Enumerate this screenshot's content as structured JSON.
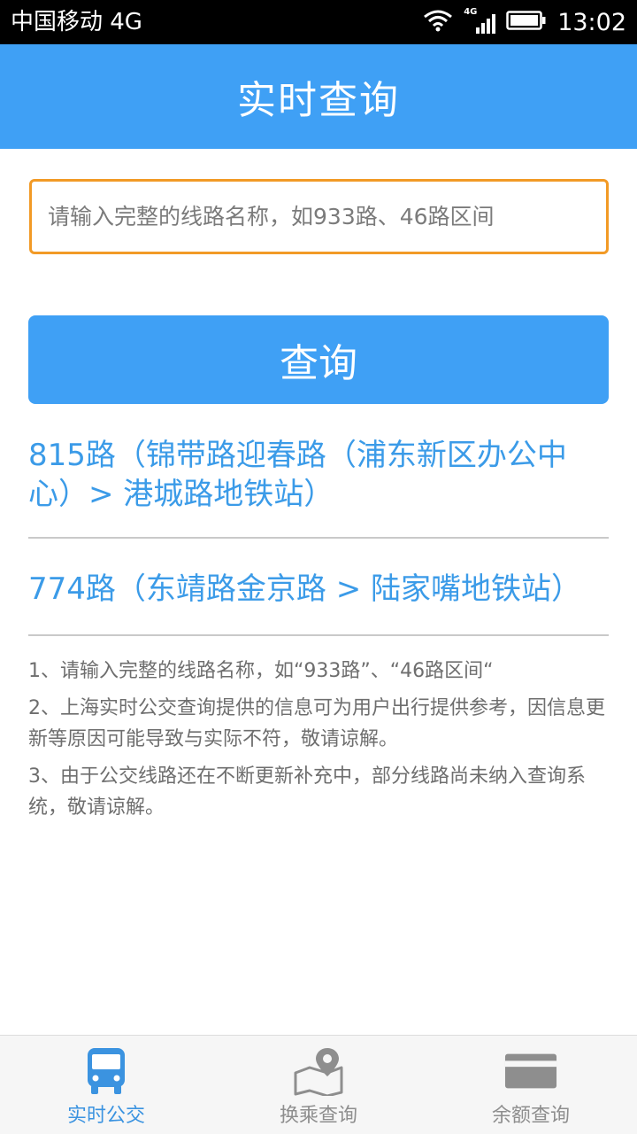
{
  "status_bar": {
    "carrier": "中国移动 4G",
    "network_tag": "4G",
    "time": "13:02"
  },
  "header": {
    "title": "实时查询"
  },
  "search": {
    "placeholder": "请输入完整的线路名称，如933路、46路区间",
    "value": ""
  },
  "query_button": {
    "label": "查询"
  },
  "results": [
    {
      "text": "815路（锦带路迎春路（浦东新区办公中心）> 港城路地铁站）"
    },
    {
      "text": "774路（东靖路金京路 > 陆家嘴地铁站）"
    }
  ],
  "notes": [
    "1、请输入完整的线路名称，如“933路”、“46路区间“",
    "2、上海实时公交查询提供的信息可为用户出行提供参考，因信息更新等原因可能导致与实际不符，敬请谅解。",
    "3、由于公交线路还在不断更新补充中，部分线路尚未纳入查询系统，敬请谅解。"
  ],
  "tabs": [
    {
      "label": "实时公交",
      "icon": "bus-icon",
      "active": true
    },
    {
      "label": "换乘查询",
      "icon": "map-pin-icon",
      "active": false
    },
    {
      "label": "余额查询",
      "icon": "card-icon",
      "active": false
    }
  ],
  "colors": {
    "primary": "#3fa0f5",
    "link": "#3b9be8",
    "input_border": "#f29a26",
    "tab_active": "#3b93e0",
    "tab_inactive": "#8e8e8e"
  }
}
